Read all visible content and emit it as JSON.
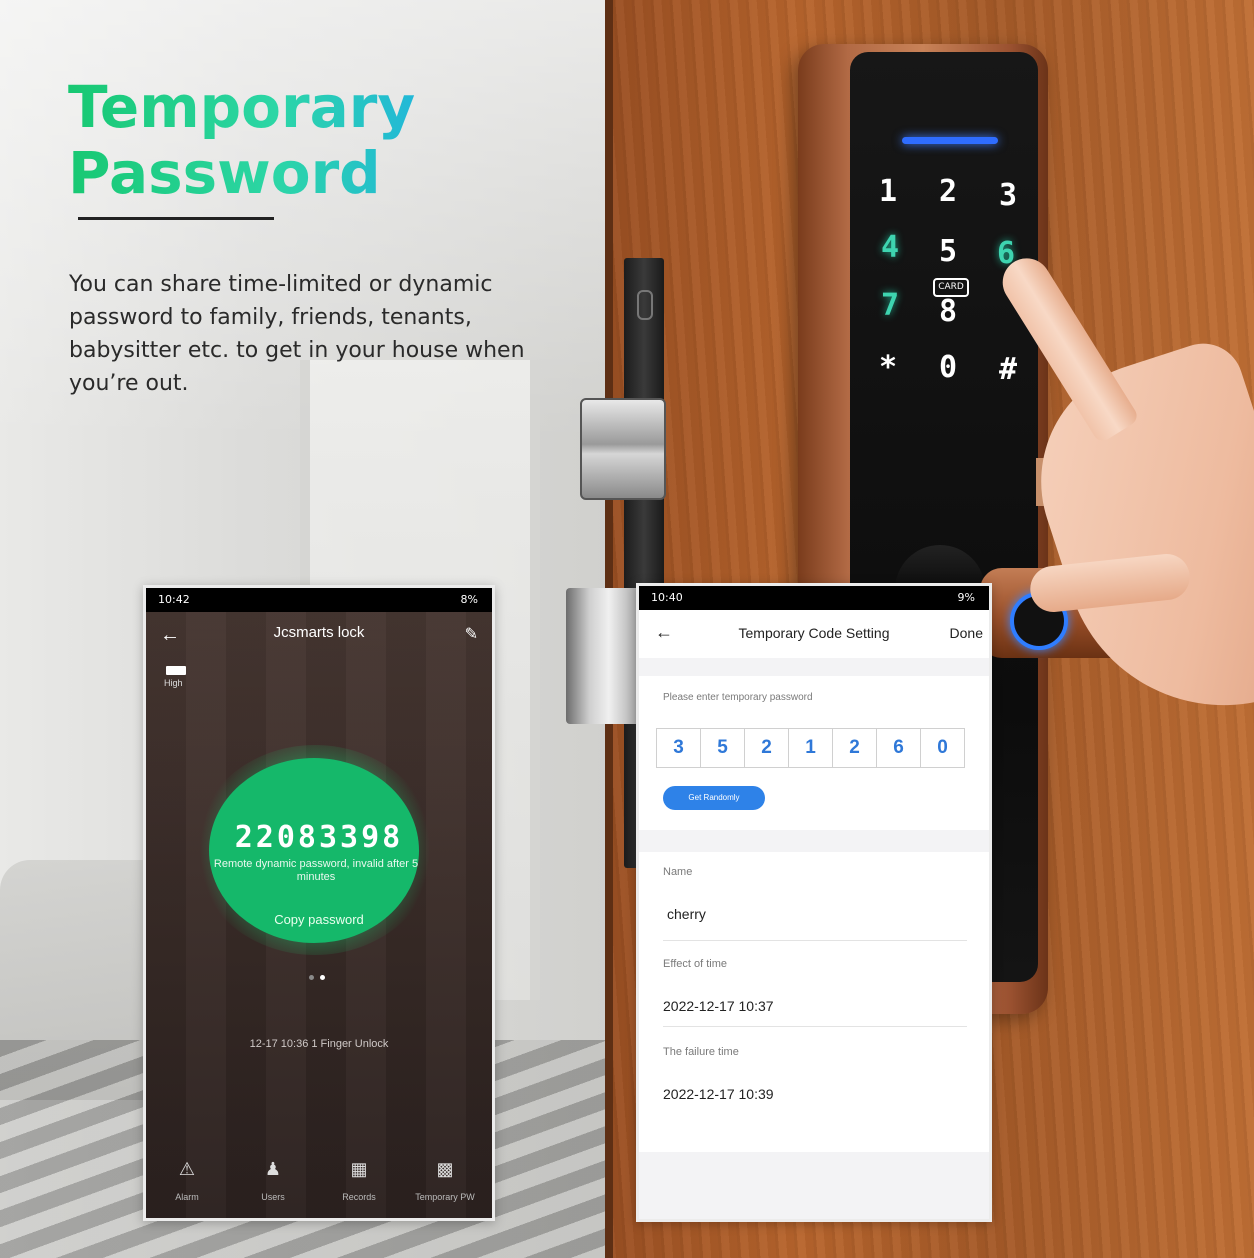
{
  "headline": {
    "line1": "Temporary",
    "line2": "Password",
    "description": "You can share time-limited or dynamic password to family, friends, tenants, babysitter etc. to get in your house when you’re out."
  },
  "keypad": {
    "keys": [
      "1",
      "2",
      "3",
      "4",
      "5",
      "6",
      "7",
      "8",
      "*",
      "0",
      "#"
    ],
    "card_label": "CARD"
  },
  "left_phone": {
    "status_time": "10:42",
    "status_right": "8%",
    "title": "Jcsmarts lock",
    "battery_label": "High",
    "password": "22083398",
    "password_note": "Remote dynamic password, invalid after 5 minutes",
    "copy_label": "Copy password",
    "log_entry": "12-17 10:36  1 Finger Unlock",
    "tabs": {
      "alarm": "Alarm",
      "users": "Users",
      "records": "Records",
      "temporary": "Temporary PW"
    }
  },
  "right_phone": {
    "status_time": "10:40",
    "status_right": "9%",
    "title": "Temporary Code Setting",
    "done_label": "Done",
    "hint": "Please enter temporary password",
    "digits": [
      "3",
      "5",
      "2",
      "1",
      "2",
      "6",
      "0"
    ],
    "random_button": "Get Randomly",
    "name_label": "Name",
    "name_value": "cherry",
    "effect_label": "Effect of time",
    "effect_value": "2022-12-17 10:37",
    "failure_label": "The failure time",
    "failure_value": "2022-12-17 10:39"
  },
  "colors": {
    "title_gradient_start": "#18c872",
    "title_gradient_end": "#22b8d8",
    "dynamic_password_circle": "#15b86a",
    "digit_color": "#2f78d8",
    "random_button": "#2e82e8",
    "fingerprint_ring": "#2f7dff"
  },
  "icons": {
    "back": "arrow-left-icon",
    "edit": "pencil-icon",
    "alarm": "alarm-icon",
    "users": "users-icon",
    "records": "calendar-icon",
    "temporary": "grid-icon"
  }
}
